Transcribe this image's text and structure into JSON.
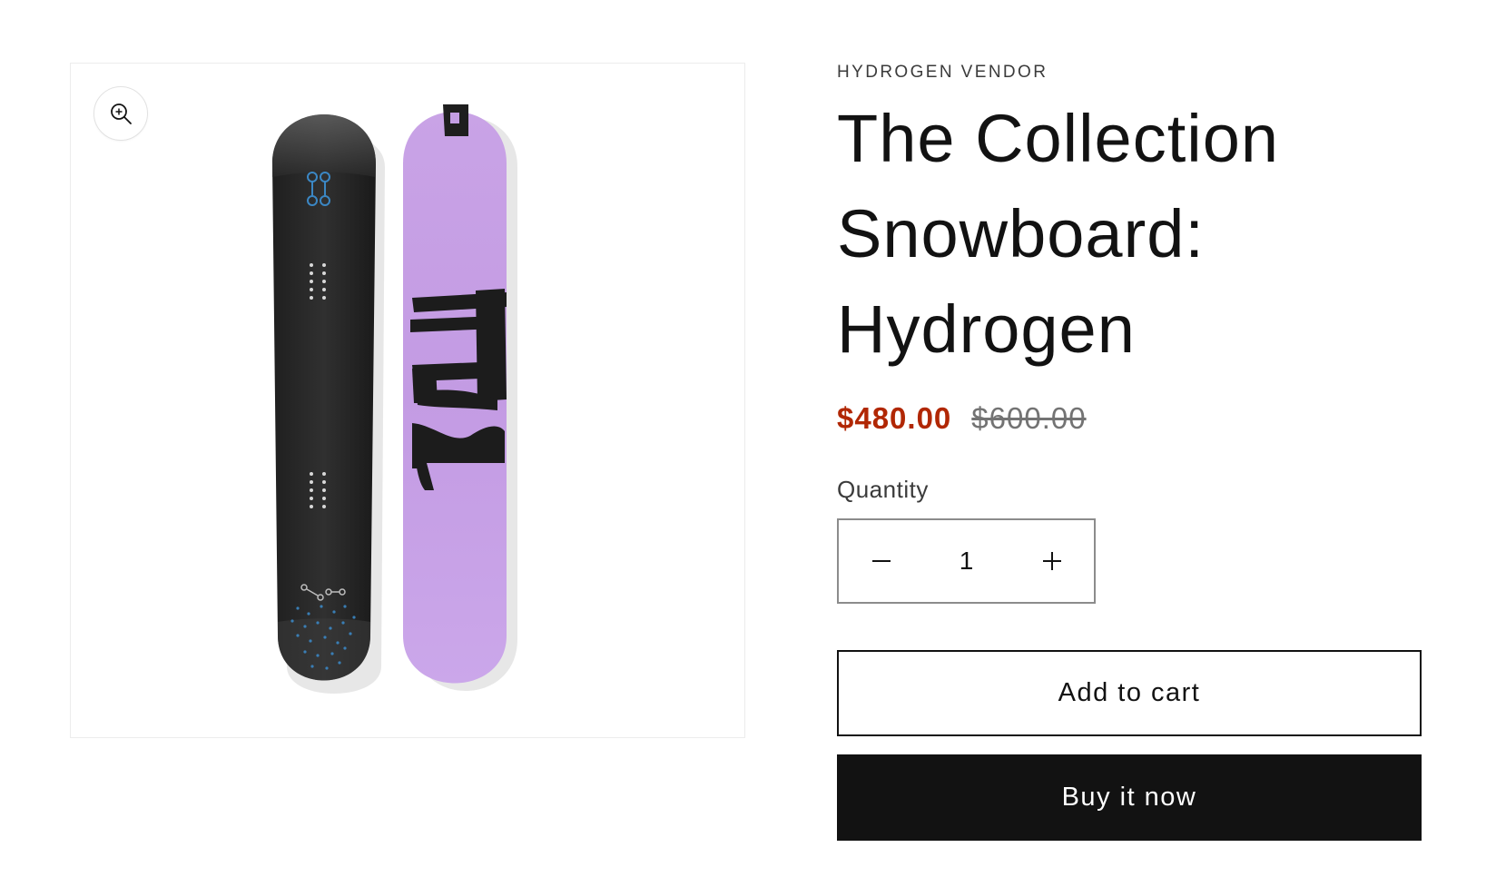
{
  "product": {
    "vendor": "HYDROGEN VENDOR",
    "title": "The Collection Snowboard: Hydrogen",
    "image_alt": "Two snowboards: a black board and a lilac board with H2 graphic",
    "zoom_icon": "zoom-in-icon"
  },
  "pricing": {
    "sale_price": "$480.00",
    "compare_price": "$600.00",
    "sale_color": "#b12704"
  },
  "quantity": {
    "label": "Quantity",
    "value": "1",
    "decrease_icon": "minus-icon",
    "increase_icon": "plus-icon"
  },
  "actions": {
    "add_to_cart": "Add to cart",
    "buy_now": "Buy it now"
  },
  "colors": {
    "accent_dark": "#121212",
    "board_black": "#2a2a2a",
    "board_lilac": "#c49ee4"
  }
}
